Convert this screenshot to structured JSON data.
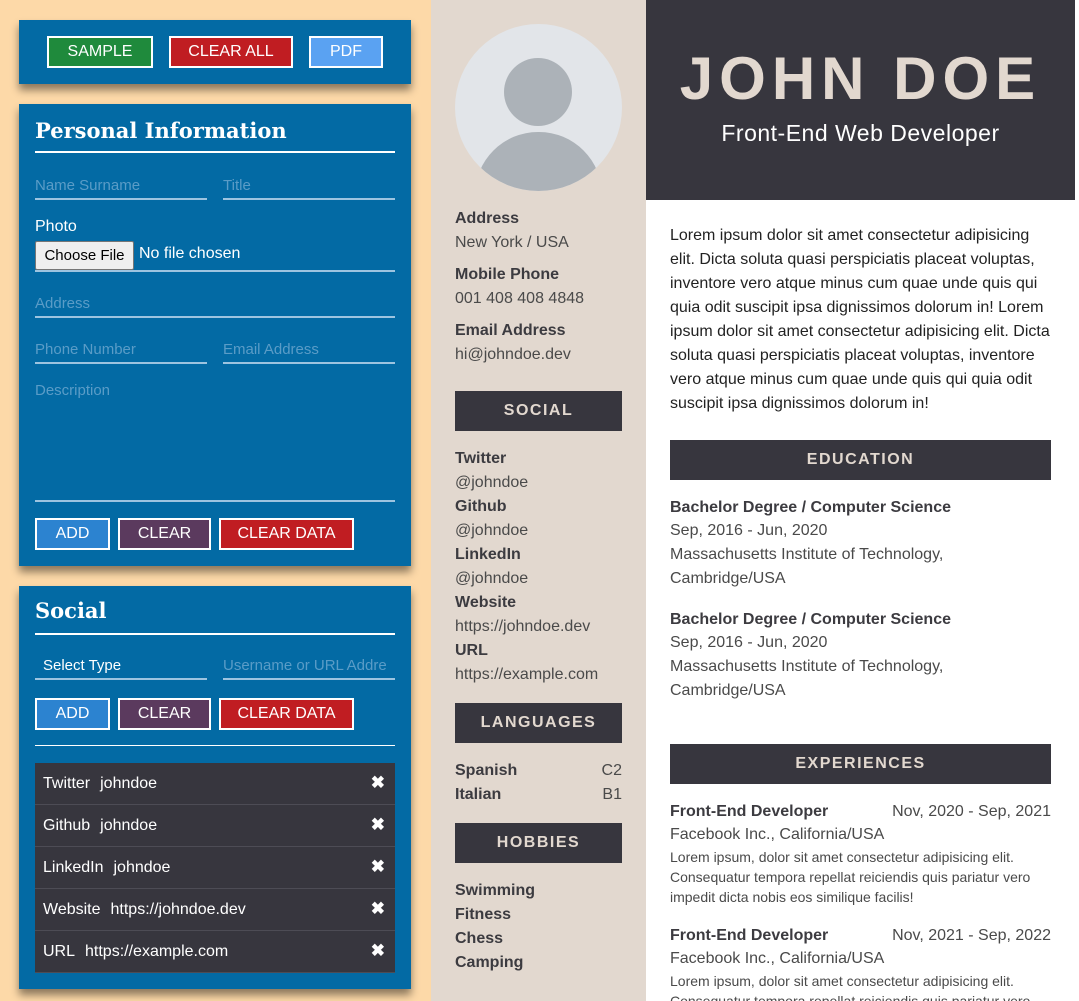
{
  "toolbar": {
    "sample": "SAMPLE",
    "clear_all": "CLEAR ALL",
    "pdf": "PDF"
  },
  "personal": {
    "title": "Personal Information",
    "name_placeholder": "Name Surname",
    "title_placeholder": "Title",
    "photo_label": "Photo",
    "choose_file": "Choose File",
    "no_file": "No file chosen",
    "address_placeholder": "Address",
    "phone_placeholder": "Phone Number",
    "email_placeholder": "Email Address",
    "description_placeholder": "Description",
    "add": "ADD",
    "clear": "CLEAR",
    "clear_data": "CLEAR DATA"
  },
  "social_form": {
    "title": "Social",
    "select_type": "Select Type",
    "url_placeholder": "Username or URL Addre",
    "add": "ADD",
    "clear": "CLEAR",
    "clear_data": "CLEAR DATA",
    "items": [
      {
        "type": "Twitter",
        "value": "johndoe"
      },
      {
        "type": "Github",
        "value": "johndoe"
      },
      {
        "type": "LinkedIn",
        "value": "johndoe"
      },
      {
        "type": "Website",
        "value": "https://johndoe.dev"
      },
      {
        "type": "URL",
        "value": "https://example.com"
      }
    ],
    "remove_glyph": "✖"
  },
  "cv": {
    "name": "JOHN DOE",
    "job": "Front-End Web Developer",
    "address_label": "Address",
    "address": "New York / USA",
    "phone_label": "Mobile Phone",
    "phone": "001 408 408 4848",
    "email_label": "Email Address",
    "email": "hi@johndoe.dev",
    "social_heading": "SOCIAL",
    "social": [
      {
        "label": "Twitter",
        "value": "@johndoe"
      },
      {
        "label": "Github",
        "value": "@johndoe"
      },
      {
        "label": "LinkedIn",
        "value": "@johndoe"
      },
      {
        "label": "Website",
        "value": "https://johndoe.dev"
      },
      {
        "label": "URL",
        "value": "https://example.com"
      }
    ],
    "languages_heading": "LANGUAGES",
    "languages": [
      {
        "name": "Spanish",
        "level": "C2"
      },
      {
        "name": "Italian",
        "level": "B1"
      }
    ],
    "hobbies_heading": "HOBBIES",
    "hobbies": [
      "Swimming",
      "Fitness",
      "Chess",
      "Camping"
    ],
    "description": "Lorem ipsum dolor sit amet consectetur adipisicing elit. Dicta soluta quasi perspiciatis placeat voluptas, inventore vero atque minus cum quae unde quis qui quia odit suscipit ipsa dignissimos dolorum in! Lorem ipsum dolor sit amet consectetur adipisicing elit. Dicta soluta quasi perspiciatis placeat voluptas, inventore vero atque minus cum quae unde quis qui quia odit suscipit ipsa dignissimos dolorum in!",
    "education_heading": "EDUCATION",
    "education": [
      {
        "degree": "Bachelor Degree / Computer Science",
        "dates": "Sep, 2016 - Jun, 2020",
        "school": "Massachusetts Institute of Technology,",
        "location": "Cambridge/USA"
      },
      {
        "degree": "Bachelor Degree / Computer Science",
        "dates": "Sep, 2016 - Jun, 2020",
        "school": "Massachusetts Institute of Technology,",
        "location": "Cambridge/USA"
      }
    ],
    "experiences_heading": "EXPERIENCES",
    "experiences": [
      {
        "role": "Front-End Developer",
        "dates": "Nov, 2020 - Sep, 2021",
        "company": "Facebook Inc., California/USA",
        "text": "Lorem ipsum, dolor sit amet consectetur adipisicing elit. Consequatur tempora repellat reiciendis quis pariatur vero impedit dicta nobis eos similique facilis!"
      },
      {
        "role": "Front-End Developer",
        "dates": "Nov, 2021 - Sep, 2022",
        "company": "Facebook Inc., California/USA",
        "text": "Lorem ipsum, dolor sit amet consectetur adipisicing elit. Consequatur tempora repellat reiciendis quis pariatur vero"
      }
    ]
  }
}
